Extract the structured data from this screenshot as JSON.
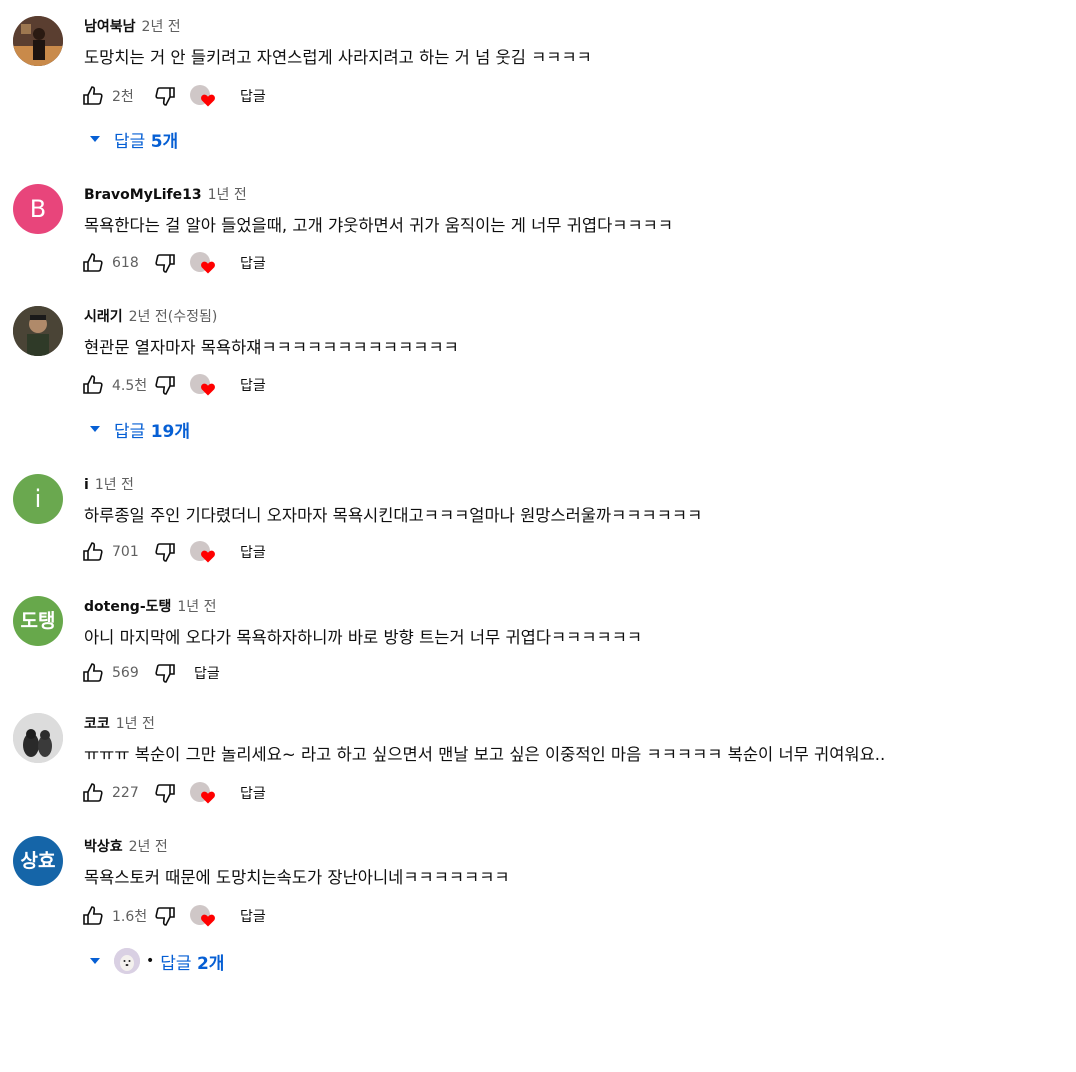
{
  "colors": {
    "link": "#065fd4",
    "heart": "#ff0000",
    "secondary": "#606060"
  },
  "comments": [
    {
      "author": "남여북남",
      "time": "2년 전",
      "edited": "",
      "text": "도망치는 거 안 들키려고 자연스럽게 사라지려고 하는 거 넘 웃김 ㅋㅋㅋㅋ",
      "likes": "2천",
      "reply_label": "답글",
      "avatar_letter": "",
      "avatar_color": "#6b4a3a",
      "replies": {
        "label": "답글",
        "count": "5개"
      }
    },
    {
      "author": "BravoMyLife13",
      "time": "1년 전",
      "edited": "",
      "text": "목욕한다는 걸 알아 들었을때, 고개 갸웃하면서 귀가 움직이는 게 너무 귀엽다ㅋㅋㅋㅋ",
      "likes": "618",
      "reply_label": "답글",
      "avatar_letter": "B",
      "avatar_color": "#e8457b"
    },
    {
      "author": "시래기",
      "time": "2년 전",
      "edited": "(수정됨)",
      "text": "현관문 열자마자 목욕하쟤ㅋㅋㅋㅋㅋㅋㅋㅋㅋㅋㅋㅋㅋ",
      "likes": "4.5천",
      "reply_label": "답글",
      "avatar_letter": "",
      "avatar_color": "#3f3a2e",
      "replies": {
        "label": "답글",
        "count": "19개"
      }
    },
    {
      "author": "i",
      "time": "1년 전",
      "edited": "",
      "text": "하루종일 주인 기다렸더니 오자마자 목욕시킨대고ㅋㅋㅋ얼마나 원망스러울까ㅋㅋㅋㅋㅋㅋ",
      "likes": "701",
      "reply_label": "답글",
      "avatar_letter": "i",
      "avatar_color": "#6aa84f"
    },
    {
      "author": "doteng-도탱",
      "time": "1년 전",
      "edited": "",
      "text": "아니 마지막에 오다가 목욕하자하니까 바로 방향 트는거 너무 귀엽다ㅋㅋㅋㅋㅋㅋ",
      "likes": "569",
      "reply_label": "답글",
      "avatar_letter": "도탱",
      "avatar_color": "#67a84b"
    },
    {
      "author": "코코",
      "time": "1년 전",
      "edited": "",
      "text": "ㅠㅠㅠ 복순이 그만 놀리세요~ 라고 하고 싶으면서 맨날 보고 싶은 이중적인 마음 ㅋㅋㅋㅋㅋ 복순이 너무 귀여워요..",
      "likes": "227",
      "reply_label": "답글",
      "avatar_letter": "",
      "avatar_color": "#d6d6d6"
    },
    {
      "author": "박상효",
      "time": "2년 전",
      "edited": "",
      "text": "목욕스토커 때문에 도망치는속도가 장난아니네ㅋㅋㅋㅋㅋㅋㅋ",
      "likes": "1.6천",
      "reply_label": "답글",
      "avatar_letter": "상효",
      "avatar_color": "#1565a8",
      "replies": {
        "label": "답글",
        "count": "2개",
        "with_avatar": true
      }
    }
  ]
}
